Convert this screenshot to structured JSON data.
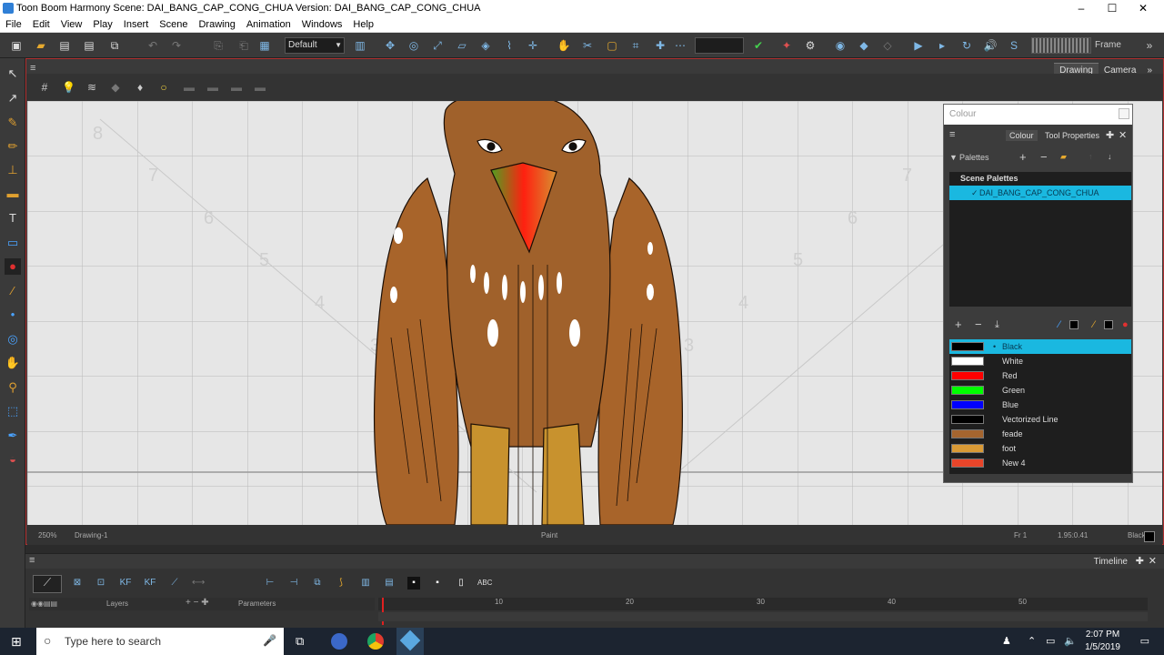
{
  "window": {
    "title": "Toon Boom Harmony Scene: DAI_BANG_CAP_CONG_CHUA Version: DAI_BANG_CAP_CONG_CHUA"
  },
  "menu": [
    "File",
    "Edit",
    "View",
    "Play",
    "Insert",
    "Scene",
    "Drawing",
    "Animation",
    "Windows",
    "Help"
  ],
  "toolbar": {
    "workspace": "Default",
    "frame_label": "Frame"
  },
  "view": {
    "tabs": [
      "Drawing",
      "Camera"
    ],
    "zoom": "250%",
    "drawing": "Drawing-1",
    "tool": "Paint",
    "frame": "Fr 1",
    "coords": "1.95:0.41",
    "current_color": "Black"
  },
  "canvas": {
    "grid_labels": [
      "8",
      "7",
      "6",
      "5",
      "4",
      "3",
      "7",
      "6",
      "5",
      "4",
      "3"
    ]
  },
  "colour_panel": {
    "title": "Colour",
    "tabs": [
      "Colour",
      "Tool Properties"
    ],
    "palettes_label": "Palettes",
    "scene_palettes_label": "Scene Palettes",
    "selected_palette": "DAI_BANG_CAP_CONG_CHUA",
    "swatches": [
      {
        "name": "Black",
        "color": "#000000"
      },
      {
        "name": "White",
        "color": "#ffffff"
      },
      {
        "name": "Red",
        "color": "#ff0000"
      },
      {
        "name": "Green",
        "color": "#00ff00"
      },
      {
        "name": "Blue",
        "color": "#0000ff"
      },
      {
        "name": "Vectorized Line",
        "color": "#000000"
      },
      {
        "name": "feade",
        "color": "#a5652f"
      },
      {
        "name": "foot",
        "color": "#d99a36"
      },
      {
        "name": "New 4",
        "color": "#e8452a"
      }
    ]
  },
  "timeline": {
    "tab": "Timeline",
    "layers_label": "Layers",
    "parameters_label": "Parameters",
    "ruler": [
      "10",
      "20",
      "30",
      "40",
      "50"
    ]
  },
  "taskbar": {
    "search_placeholder": "Type here to search",
    "time": "2:07 PM",
    "date": "1/5/2019"
  }
}
